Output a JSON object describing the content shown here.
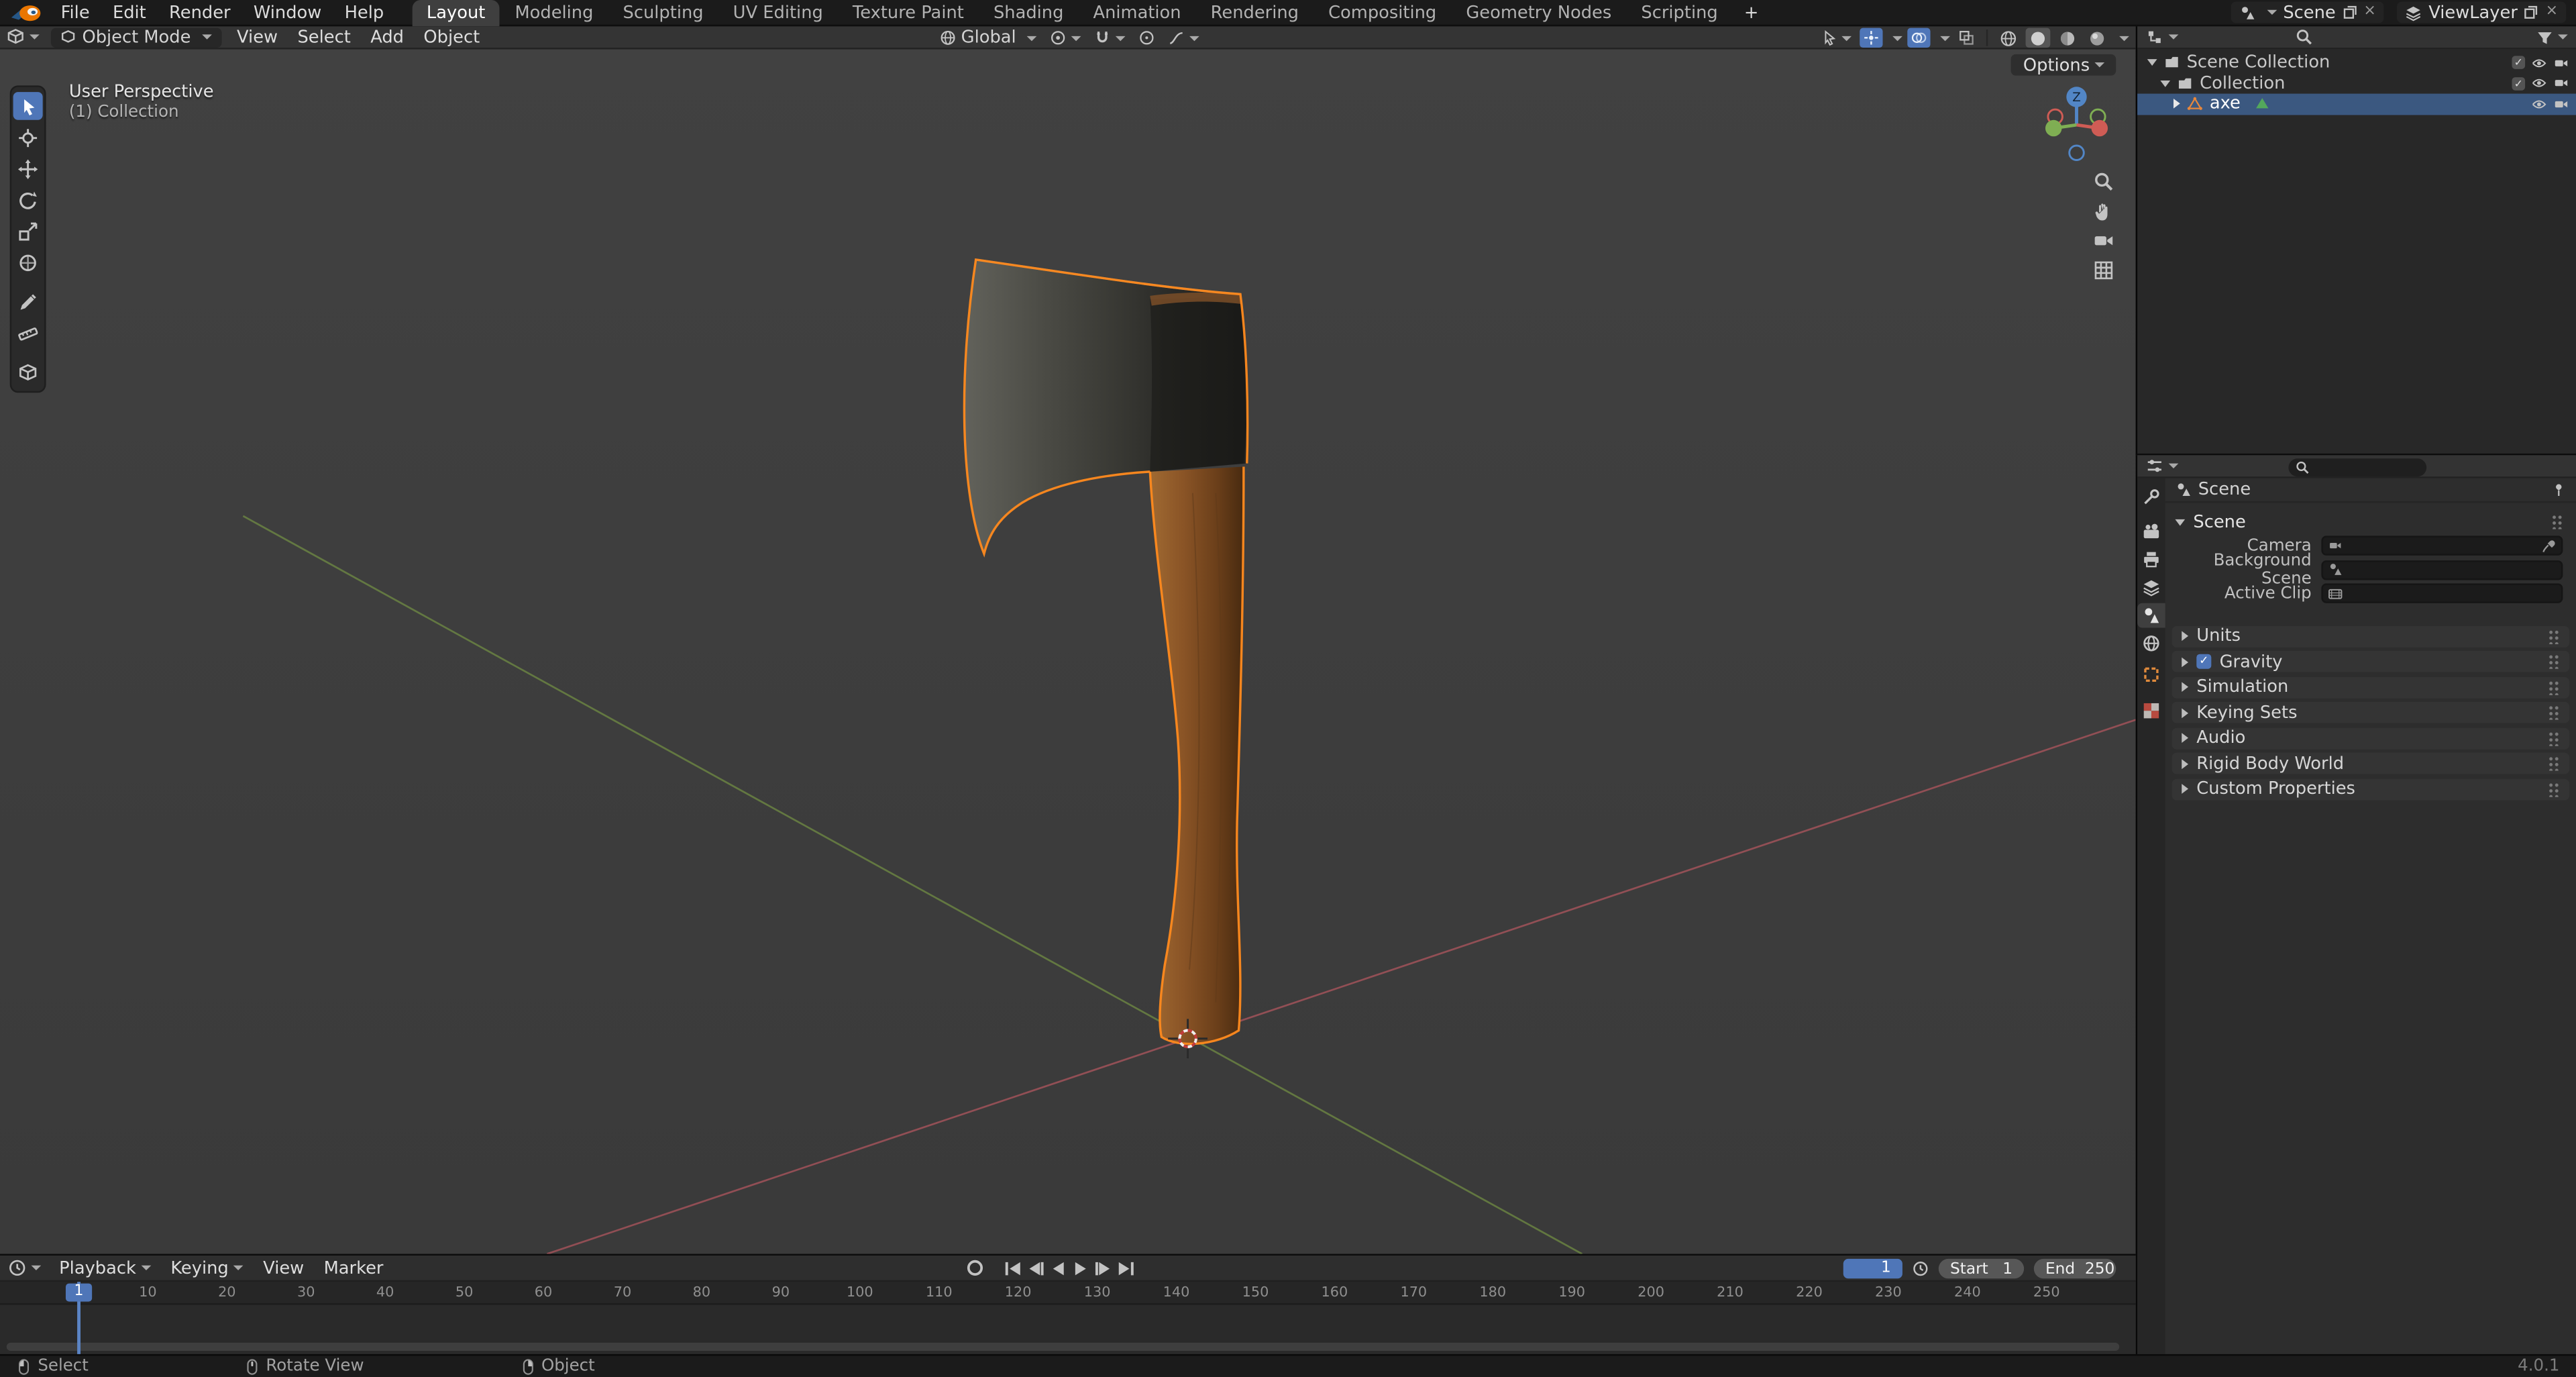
{
  "colors": {
    "accent": "#4772b3",
    "selection_outline": "#ff8a1e",
    "axis_x": "#a8545c",
    "axis_y": "#6d8743",
    "object_orange": "#e8873b",
    "mesh_data_green": "#53a85c"
  },
  "topbar": {
    "menus": [
      "File",
      "Edit",
      "Render",
      "Window",
      "Help"
    ],
    "workspace_tabs": [
      {
        "label": "Layout",
        "active": true
      },
      {
        "label": "Modeling"
      },
      {
        "label": "Sculpting"
      },
      {
        "label": "UV Editing"
      },
      {
        "label": "Texture Paint"
      },
      {
        "label": "Shading"
      },
      {
        "label": "Animation"
      },
      {
        "label": "Rendering"
      },
      {
        "label": "Compositing"
      },
      {
        "label": "Geometry Nodes"
      },
      {
        "label": "Scripting"
      }
    ],
    "add_workspace_label": "+",
    "scene_name": "Scene",
    "view_layer_name": "ViewLayer"
  },
  "viewport": {
    "header": {
      "mode": "Object Mode",
      "menus": [
        "View",
        "Select",
        "Add",
        "Object"
      ],
      "orientation": "Global",
      "options_label": "Options"
    },
    "overlay": {
      "perspective": "User Perspective",
      "collection": "(1) Collection"
    },
    "gizmo": {
      "z_label": "Z"
    },
    "toolbar_tools": [
      "tweak-select",
      "cursor",
      "move",
      "rotate",
      "scale",
      "transform",
      "annotate",
      "measure",
      "add-cube"
    ],
    "active_tool": "tweak-select",
    "side_icons": [
      "zoom",
      "pan",
      "camera-view",
      "toggle-ortho"
    ]
  },
  "outliner": {
    "rows": [
      {
        "label": "Scene Collection"
      },
      {
        "label": "Collection"
      },
      {
        "label": "axe",
        "selected": true
      }
    ]
  },
  "properties": {
    "tabs": [
      "tool",
      "render",
      "output",
      "view-layer",
      "scene",
      "world",
      "object",
      "texture"
    ],
    "active_tab": "scene",
    "breadcrumb": "Scene",
    "scene_panel": {
      "label": "Scene",
      "camera_label": "Camera",
      "background_label": "Background Scene",
      "clip_label": "Active Clip"
    },
    "collapsed_panels": {
      "units": "Units",
      "gravity": "Gravity",
      "gravity_checked": true,
      "gravity_check_glyph": "✓",
      "simulation": "Simulation",
      "keying_sets": "Keying Sets",
      "audio": "Audio",
      "rigid_body": "Rigid Body World",
      "custom_props": "Custom Properties"
    }
  },
  "timeline": {
    "menus": {
      "playback": "Playback",
      "keying": "Keying",
      "view": "View",
      "marker": "Marker"
    },
    "current_frame": "1",
    "playhead_label": "1",
    "start_label": "Start",
    "start_value": "1",
    "end_label": "End",
    "end_value": "250",
    "ruler_ticks": [
      "10",
      "20",
      "30",
      "40",
      "50",
      "60",
      "70",
      "80",
      "90",
      "100",
      "110",
      "120",
      "130",
      "140",
      "150",
      "160",
      "170",
      "180",
      "190",
      "200",
      "210",
      "220",
      "230",
      "240",
      "250"
    ]
  },
  "statusbar": {
    "hints": [
      {
        "label": "Select",
        "button": "left"
      },
      {
        "label": "Rotate View",
        "button": "middle"
      },
      {
        "label": "Object",
        "button": "right"
      }
    ],
    "version": "4.0.1"
  }
}
